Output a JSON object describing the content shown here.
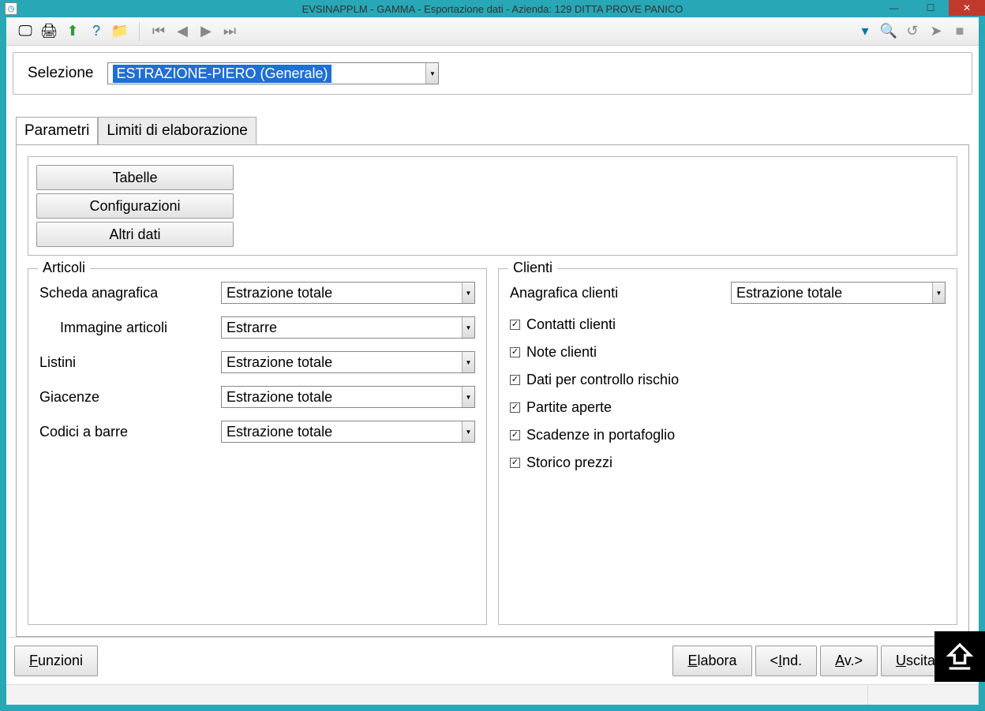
{
  "window": {
    "title": "EVSINAPPLM - GAMMA - Esportazione dati - Azienda:  129 DITTA PROVE PANICO"
  },
  "toolbar": {
    "icons": [
      "print-preview-icon",
      "print-icon",
      "export-icon",
      "help-icon",
      "folder-icon"
    ],
    "nav_icons": [
      "first-icon",
      "prev-icon",
      "next-icon",
      "last-icon"
    ],
    "right_icons": [
      "dropdown-icon",
      "search-icon",
      "undo-icon",
      "forward-icon",
      "stop-icon"
    ]
  },
  "selection": {
    "label": "Selezione",
    "value": "ESTRAZIONE-PIERO (Generale)"
  },
  "tabs": {
    "parametri": "Parametri",
    "limiti": "Limiti di elaborazione"
  },
  "buttons_group": {
    "tabelle": "Tabelle",
    "configurazioni": "Configurazioni",
    "altri_dati": "Altri dati"
  },
  "articoli": {
    "title": "Articoli",
    "rows": {
      "scheda": {
        "label": "Scheda anagrafica",
        "value": "Estrazione totale"
      },
      "immagine": {
        "label": "Immagine articoli",
        "value": "Estrarre"
      },
      "listini": {
        "label": "Listini",
        "value": "Estrazione totale"
      },
      "giacenze": {
        "label": "Giacenze",
        "value": "Estrazione totale"
      },
      "codici": {
        "label": "Codici a barre",
        "value": "Estrazione totale"
      }
    }
  },
  "clienti": {
    "title": "Clienti",
    "anagrafica": {
      "label": "Anagrafica clienti",
      "value": "Estrazione totale"
    },
    "checks": {
      "contatti": "Contatti clienti",
      "note": "Note clienti",
      "rischio": "Dati per controllo rischio",
      "partite": "Partite aperte",
      "scadenze": "Scadenze in portafoglio",
      "storico": "Storico prezzi"
    }
  },
  "footer": {
    "funzioni": "Funzioni",
    "elabora": "Elabora",
    "ind": "<Ind.",
    "av": "Av.>",
    "uscita": "Uscita"
  }
}
